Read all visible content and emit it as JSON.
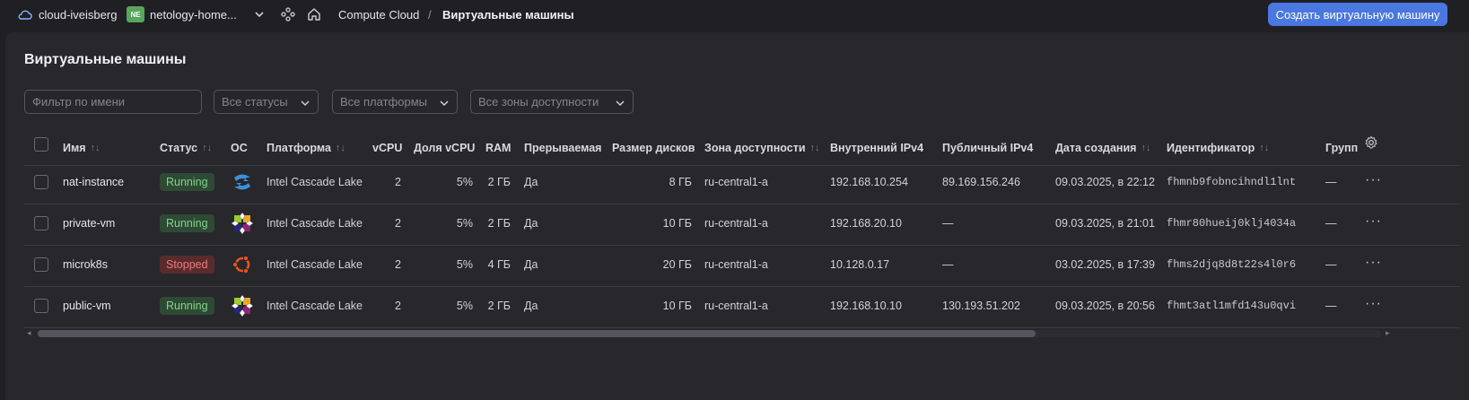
{
  "topbar": {
    "cloud_name": "cloud-iveisberg",
    "folder_badge": "NE",
    "folder_name": "netology-home...",
    "breadcrumb_service": "Compute Cloud",
    "breadcrumb_sep": "/",
    "breadcrumb_page": "Виртуальные машины",
    "create_button": "Создать виртуальную машину",
    "accent_color": "#4a77e0"
  },
  "page": {
    "title": "Виртуальные машины"
  },
  "filters": {
    "name_placeholder": "Фильтр по имени",
    "status": "Все статусы",
    "platform": "Все платформы",
    "zone": "Все зоны доступности"
  },
  "table": {
    "columns": {
      "name": "Имя",
      "status": "Статус",
      "os": "ОС",
      "platform": "Платформа",
      "vcpu": "vCPU",
      "vcpu_share": "Доля vCPU",
      "ram": "RAM",
      "preemptible": "Прерываемая",
      "disk": "Размер дисков",
      "zone": "Зона доступности",
      "ipv4_int": "Внутренний IPv4",
      "ipv4_pub": "Публичный IPv4",
      "created": "Дата создания",
      "id": "Идентификатор",
      "group": "Групп"
    },
    "sort_icon": "↑↓",
    "rows": [
      {
        "name": "nat-instance",
        "status": "Running",
        "os": "nat-instance-os-icon",
        "platform": "Intel Cascade Lake",
        "vcpu": "2",
        "vcpu_share": "5%",
        "ram": "2 ГБ",
        "preemptible": "Да",
        "disk": "8 ГБ",
        "zone": "ru-central1-a",
        "ipv4_int": "192.168.10.254",
        "ipv4_pub": "89.169.156.246",
        "created": "09.03.2025, в 22:12",
        "id": "fhmnb9fobncihndl1lnt",
        "group": "—"
      },
      {
        "name": "private-vm",
        "status": "Running",
        "os": "centos-icon",
        "platform": "Intel Cascade Lake",
        "vcpu": "2",
        "vcpu_share": "5%",
        "ram": "2 ГБ",
        "preemptible": "Да",
        "disk": "10 ГБ",
        "zone": "ru-central1-a",
        "ipv4_int": "192.168.20.10",
        "ipv4_pub": "—",
        "created": "09.03.2025, в 21:01",
        "id": "fhmr80hueij0klj4034a",
        "group": "—"
      },
      {
        "name": "microk8s",
        "status": "Stopped",
        "os": "ubuntu-icon",
        "platform": "Intel Cascade Lake",
        "vcpu": "2",
        "vcpu_share": "5%",
        "ram": "4 ГБ",
        "preemptible": "Да",
        "disk": "20 ГБ",
        "zone": "ru-central1-a",
        "ipv4_int": "10.128.0.17",
        "ipv4_pub": "—",
        "created": "03.02.2025, в 17:39",
        "id": "fhms2djq8d8t22s4l0r6",
        "group": "—"
      },
      {
        "name": "public-vm",
        "status": "Running",
        "os": "centos-icon",
        "platform": "Intel Cascade Lake",
        "vcpu": "2",
        "vcpu_share": "5%",
        "ram": "2 ГБ",
        "preemptible": "Да",
        "disk": "10 ГБ",
        "zone": "ru-central1-a",
        "ipv4_int": "192.168.10.10",
        "ipv4_pub": "130.193.51.202",
        "created": "09.03.2025, в 20:56",
        "id": "fhmt3atl1mfd143u0qvi",
        "group": "—"
      }
    ],
    "row_menu": "···"
  },
  "scrollbar": {
    "left_arrow": "◂",
    "right_arrow": "▸"
  }
}
